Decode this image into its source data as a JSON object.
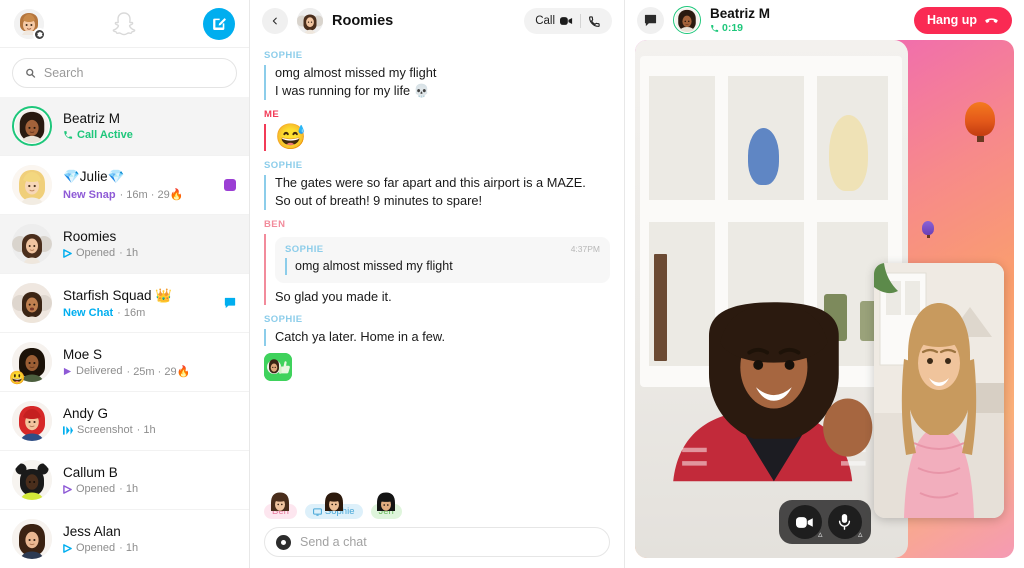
{
  "sidebar": {
    "profile_icon": "profile-avatar",
    "gear_icon": "gear-icon",
    "ghost_icon": "snapchat-ghost-icon",
    "compose_icon": "compose-new-chat-icon",
    "search": {
      "placeholder": "Search",
      "value": "",
      "icon": "search-icon"
    },
    "chats": [
      {
        "name": "Beatriz M",
        "status": "Call Active",
        "status_color": "green",
        "icon": "phone-icon",
        "meta": "",
        "badge": "",
        "active": true,
        "emoji": ""
      },
      {
        "name": "💎Julie💎",
        "status": "New Snap",
        "status_color": "purple",
        "icon": "",
        "meta": "· 16m · 29🔥",
        "badge": "square-purple",
        "active": false,
        "emoji": ""
      },
      {
        "name": "Roomies",
        "status": "Opened",
        "status_color": "gray",
        "icon": "play-triangle-blue",
        "meta": "· 1h",
        "badge": "",
        "active": true,
        "emoji": ""
      },
      {
        "name": "Starfish Squad 👑",
        "status": "New Chat",
        "status_color": "blue",
        "icon": "",
        "meta": "· 16m",
        "badge": "bubble-blue",
        "active": false,
        "emoji": ""
      },
      {
        "name": "Moe S",
        "status": "Delivered",
        "status_color": "gray",
        "icon": "play-triangle-purple",
        "meta": "· 25m · 29🔥",
        "badge": "",
        "active": false,
        "emoji": "😃"
      },
      {
        "name": "Andy G",
        "status": "Screenshot",
        "status_color": "gray",
        "icon": "screenshot-arrows-blue",
        "meta": "· 1h",
        "badge": "",
        "active": false,
        "emoji": ""
      },
      {
        "name": "Callum B",
        "status": "Opened",
        "status_color": "gray",
        "icon": "play-triangle-purple",
        "meta": "· 1h",
        "badge": "",
        "active": false,
        "emoji": ""
      },
      {
        "name": "Jess Alan",
        "status": "Opened",
        "status_color": "gray",
        "icon": "play-triangle-blue",
        "meta": "· 1h",
        "badge": "",
        "active": false,
        "emoji": ""
      }
    ]
  },
  "chat": {
    "back_icon": "back-chevron-icon",
    "avatar_icon": "group-avatar",
    "title": "Roomies",
    "call_label": "Call",
    "video_icon": "video-camera-icon",
    "phone_icon": "phone-handset-icon",
    "messages": [
      {
        "author": "SOPHIE",
        "style": "sophie",
        "type": "text",
        "lines": [
          "omg almost missed my flight",
          "I was running for my life 💀"
        ]
      },
      {
        "author": "ME",
        "style": "me",
        "type": "emoji",
        "lines": [
          "😅"
        ]
      },
      {
        "author": "BEN",
        "style": "ben",
        "type": "quote",
        "quote": {
          "author": "SOPHIE",
          "time": "4:37PM",
          "text": "omg almost missed my flight"
        },
        "lines": [
          "So glad you made it."
        ]
      },
      {
        "author": "SOPHIE",
        "style": "sophie",
        "type": "sticker",
        "lines": [
          "Catch ya later. Home in a few."
        ],
        "sticker": "thumbs-up-bitmoji-sticker"
      }
    ],
    "presence": [
      {
        "name": "Ben",
        "style": "ben",
        "icon": ""
      },
      {
        "name": "Sophie",
        "style": "sophie",
        "icon": "desktop-screen-icon"
      },
      {
        "name": "Jen",
        "style": "jen",
        "icon": ""
      }
    ],
    "composer": {
      "placeholder": "Send a chat",
      "value": "",
      "icon": "camera-icon"
    }
  },
  "video": {
    "chat_icon": "chat-bubble-icon",
    "avatar_icon": "caller-avatar",
    "name": "Beatriz M",
    "duration": "0:19",
    "duration_icon": "phone-icon",
    "hangup_label": "Hang up",
    "hangup_icon": "hangup-handset-icon",
    "hangup_color": "#fa2a53",
    "accent_green": "#1ec77b",
    "controls": [
      {
        "name": "camera-toggle",
        "icon": "video-camera-icon"
      },
      {
        "name": "mic-toggle",
        "icon": "microphone-icon"
      }
    ]
  }
}
